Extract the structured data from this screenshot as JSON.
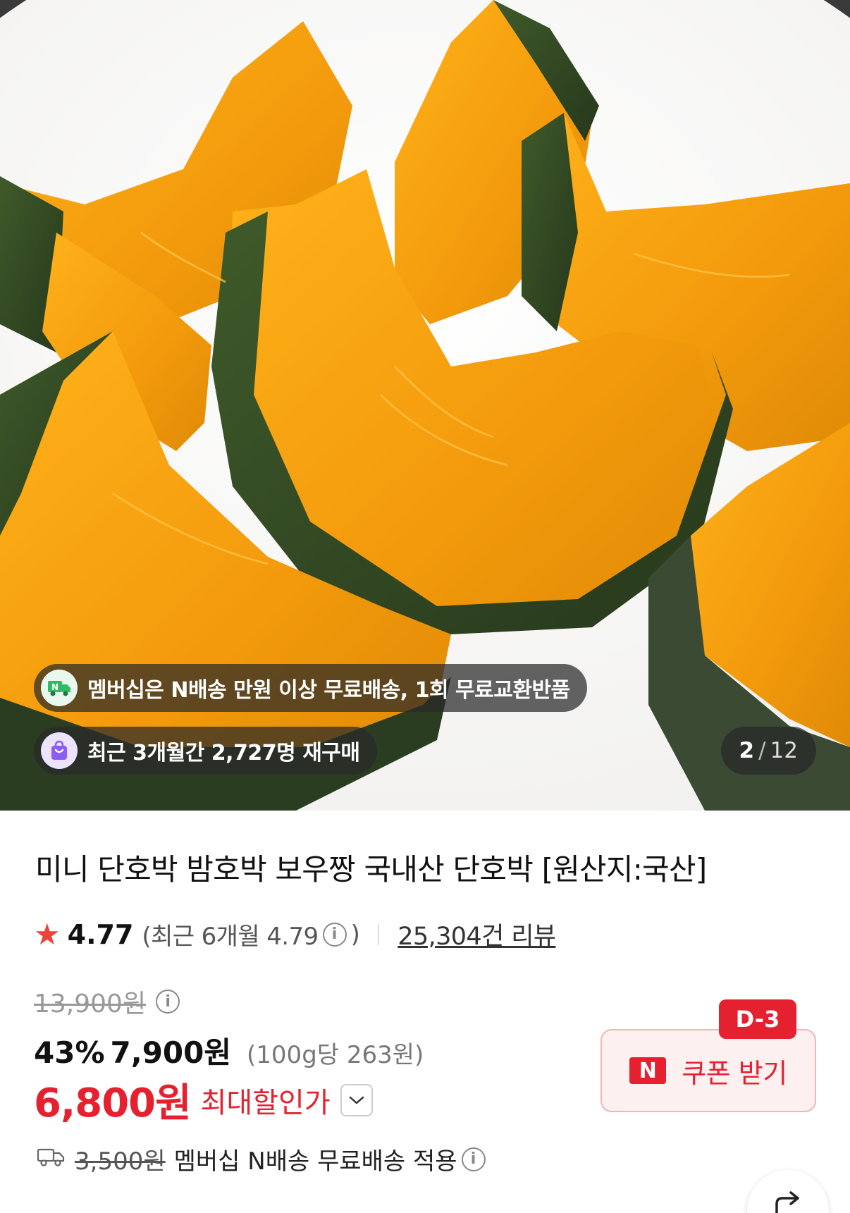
{
  "hero": {
    "membership_notice": "멤버십은 N배송 만원 이상 무료배송, 1회 무료교환반품",
    "repurchase_notice": "최근 3개월간 2,727명 재구매",
    "counter_current": "2",
    "counter_separator": "/",
    "counter_total": "12"
  },
  "product": {
    "title": "미니 단호박 밤호박 보우짱 국내산 단호박 [원산지:국산]",
    "rating": "4.77",
    "recent_rating_prefix": "(최근 6개월 4.79",
    "recent_rating_suffix": ")",
    "review_count": "25,304건 리뷰",
    "original_price": "13,900원",
    "discount_rate": "43%",
    "sale_price": "7,900원",
    "unit_price": "(100g당 263원)",
    "max_discount_price": "6,800원",
    "max_discount_label": "최대할인가"
  },
  "coupon": {
    "dday": "D-3",
    "logo": "N",
    "label": "쿠폰 받기"
  },
  "shipping": {
    "original_fee": "3,500원",
    "text": "멤버십 N배송 무료배송 적용"
  },
  "colors": {
    "accent_red": "#e5202f",
    "star": "#f0413c"
  },
  "icons": [
    "truck-n-icon",
    "shopping-bag-icon",
    "star-icon",
    "info-icon",
    "chevron-down-icon",
    "delivery-truck-icon",
    "share-icon"
  ]
}
